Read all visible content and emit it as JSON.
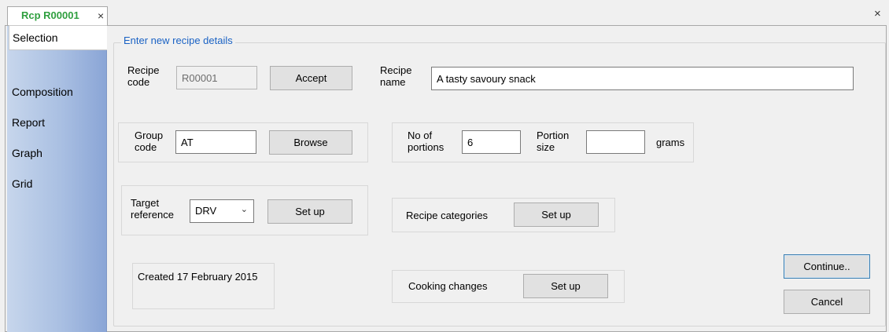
{
  "tab": {
    "title": "Rcp R00001",
    "close": "×"
  },
  "window": {
    "close": "×"
  },
  "sidebar": {
    "items": [
      {
        "label": "Selection"
      },
      {
        "label": "Composition"
      },
      {
        "label": "Report"
      },
      {
        "label": "Graph"
      },
      {
        "label": "Grid"
      }
    ],
    "active": "Selection"
  },
  "form": {
    "group_title": "Enter new recipe details",
    "recipe_code": {
      "label_line1": "Recipe",
      "label_line2": "code",
      "value": "R00001",
      "button": "Accept"
    },
    "recipe_name": {
      "label_line1": "Recipe",
      "label_line2": "name",
      "value": "A tasty savoury snack"
    },
    "group_code": {
      "label_line1": "Group",
      "label_line2": "code",
      "value": "AT",
      "button": "Browse"
    },
    "portions": {
      "label_line1": "No of",
      "label_line2": "portions",
      "value": "6",
      "size_label_line1": "Portion",
      "size_label_line2": "size",
      "size_value": "",
      "unit": "grams"
    },
    "target_reference": {
      "label_line1": "Target",
      "label_line2": "reference",
      "selected": "DRV",
      "button": "Set up"
    },
    "recipe_categories": {
      "label": "Recipe categories",
      "button": "Set up"
    },
    "created": {
      "text": "Created 17 February 2015"
    },
    "cooking_changes": {
      "label": "Cooking changes",
      "button": "Set up"
    },
    "continue_label": "Continue..",
    "cancel_label": "Cancel"
  },
  "icons": {
    "close": "close-icon",
    "dropdown": "chevron-down-icon"
  }
}
